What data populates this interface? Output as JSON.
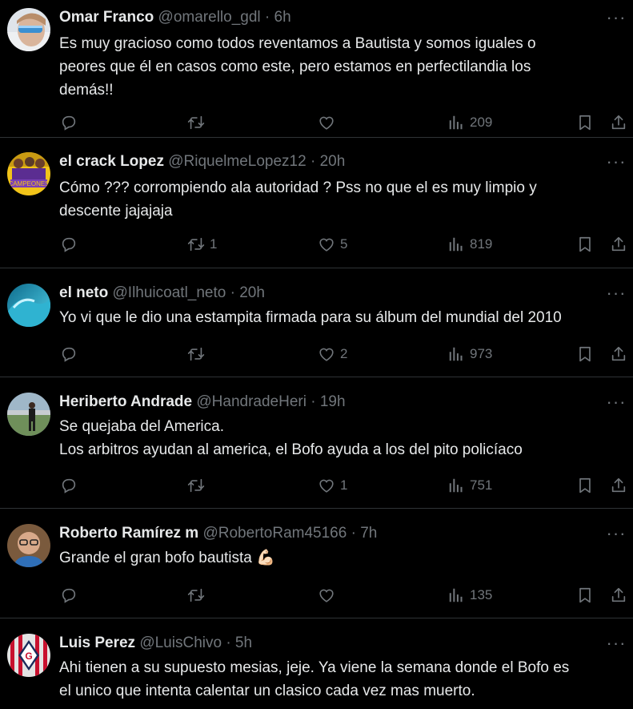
{
  "tweets": [
    {
      "name": "Omar Franco",
      "handle": "@omarello_gdl",
      "time": "· 6h",
      "lines": [
        "Es muy gracioso como todos reventamos a Bautista y somos iguales o",
        "peores que él en casos como este, pero estamos en perfectilandia los",
        "demás!!"
      ],
      "replies": "",
      "retweets": "",
      "likes": "",
      "views": "209",
      "avatar": "sunglasses-selfie"
    },
    {
      "name": "el crack Lopez",
      "handle": "@RiquelmeLopez12",
      "time": "· 20h",
      "lines": [
        "Cómo ??? corrompiendo ala autoridad  ? Pss no que el es muy limpio y",
        "descente jajajaja"
      ],
      "replies": "",
      "retweets": "1",
      "likes": "5",
      "views": "819",
      "avatar": "team-campeones"
    },
    {
      "name": "el neto",
      "handle": "@Ilhuicoatl_neto",
      "time": "· 20h",
      "lines": [
        "Yo vi que le dio una estampita firmada para su álbum del mundial del 2010"
      ],
      "replies": "",
      "retweets": "",
      "likes": "2",
      "views": "973",
      "avatar": "ocean-wave"
    },
    {
      "name": "Heriberto Andrade",
      "handle": "@HandradeHeri",
      "time": "· 19h",
      "lines": [
        "Se quejaba del America.",
        "Los arbitros ayudan al america, el Bofo ayuda a los del pito policíaco"
      ],
      "replies": "",
      "retweets": "",
      "likes": "1",
      "views": "751",
      "avatar": "man-standing"
    },
    {
      "name": "Roberto Ramírez m",
      "handle": "@RobertoRam45166",
      "time": "· 7h",
      "lines": [
        "Grande el gran bofo bautista 💪🏻"
      ],
      "replies": "",
      "retweets": "",
      "likes": "",
      "views": "135",
      "avatar": "man-glasses"
    },
    {
      "name": "Luis Perez",
      "handle": "@LuisChivo",
      "time": "· 5h",
      "lines": [
        "Ahi tienen a su supuesto mesias, jeje. Ya viene la semana donde el Bofo es",
        "el unico que intenta calentar un clasico cada vez mas muerto."
      ],
      "replies": "",
      "retweets": "",
      "likes": "",
      "views": "",
      "avatar": "chivas-crest"
    }
  ],
  "more_icon": "more-options-icon",
  "colors": {
    "background": "#000000",
    "text": "#e7e9ea",
    "secondary": "#71767b",
    "divider": "#2f3336"
  }
}
